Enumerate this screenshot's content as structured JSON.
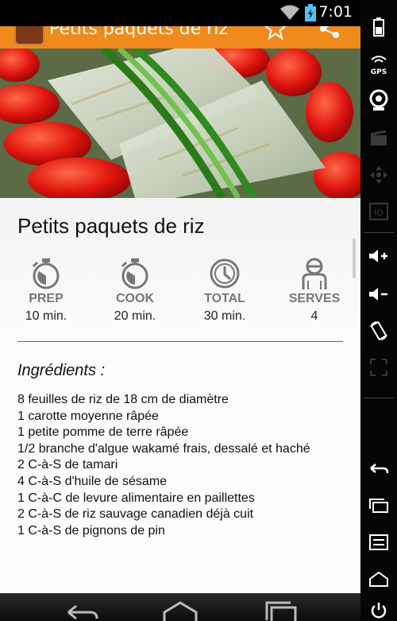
{
  "status_bar": {
    "time": "7:01"
  },
  "action_bar": {
    "title": "Petits paquets de riz"
  },
  "recipe": {
    "title": "Petits paquets de riz",
    "stats": [
      {
        "label": "PREP",
        "value": "10 min.",
        "icon": "stopwatch-icon"
      },
      {
        "label": "COOK",
        "value": "20 min.",
        "icon": "stopwatch-icon"
      },
      {
        "label": "TOTAL",
        "value": "30 min.",
        "icon": "clock-icon"
      },
      {
        "label": "SERVES",
        "value": "4",
        "icon": "person-icon"
      }
    ],
    "ingredients_heading": "Ingrédients :",
    "ingredients": [
      "8 feuilles de riz de 18 cm de diamètre",
      "1 carotte moyenne râpée",
      "1 petite pomme de terre râpée",
      "1/2 branche d'algue wakamé frais, dessalé et haché",
      "2 C-à-S de tamari",
      "4 C-à-S d'huile de sésame",
      "1 C-à-C de levure alimentaire en paillettes",
      "2 C-à-S de riz sauvage canadien déjà cuit",
      "1 C-à-S de pignons de pin"
    ]
  },
  "colors": {
    "accent": "#f08a1c",
    "stat_label": "#777777"
  },
  "emulator_controls": [
    "battery-icon",
    "gps-icon",
    "camera-icon",
    "clapper-icon",
    "dpad-icon",
    "id-icon",
    "volume-up-icon",
    "volume-down-icon",
    "rotate-icon",
    "resize-icon",
    "back-icon",
    "recents-icon",
    "menu-icon",
    "home-icon",
    "power-icon"
  ]
}
